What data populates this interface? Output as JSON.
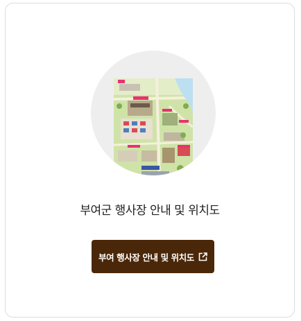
{
  "card": {
    "title": "부여군 행사장 안내 및 위치도",
    "button_label": "부여 행사장 안내 및 위치도",
    "button_icon": "external-link-icon"
  },
  "colors": {
    "button_bg": "#4a2708",
    "button_text": "#ffffff",
    "circle_bg": "#eeeeee",
    "card_border": "#dcdcdc"
  }
}
